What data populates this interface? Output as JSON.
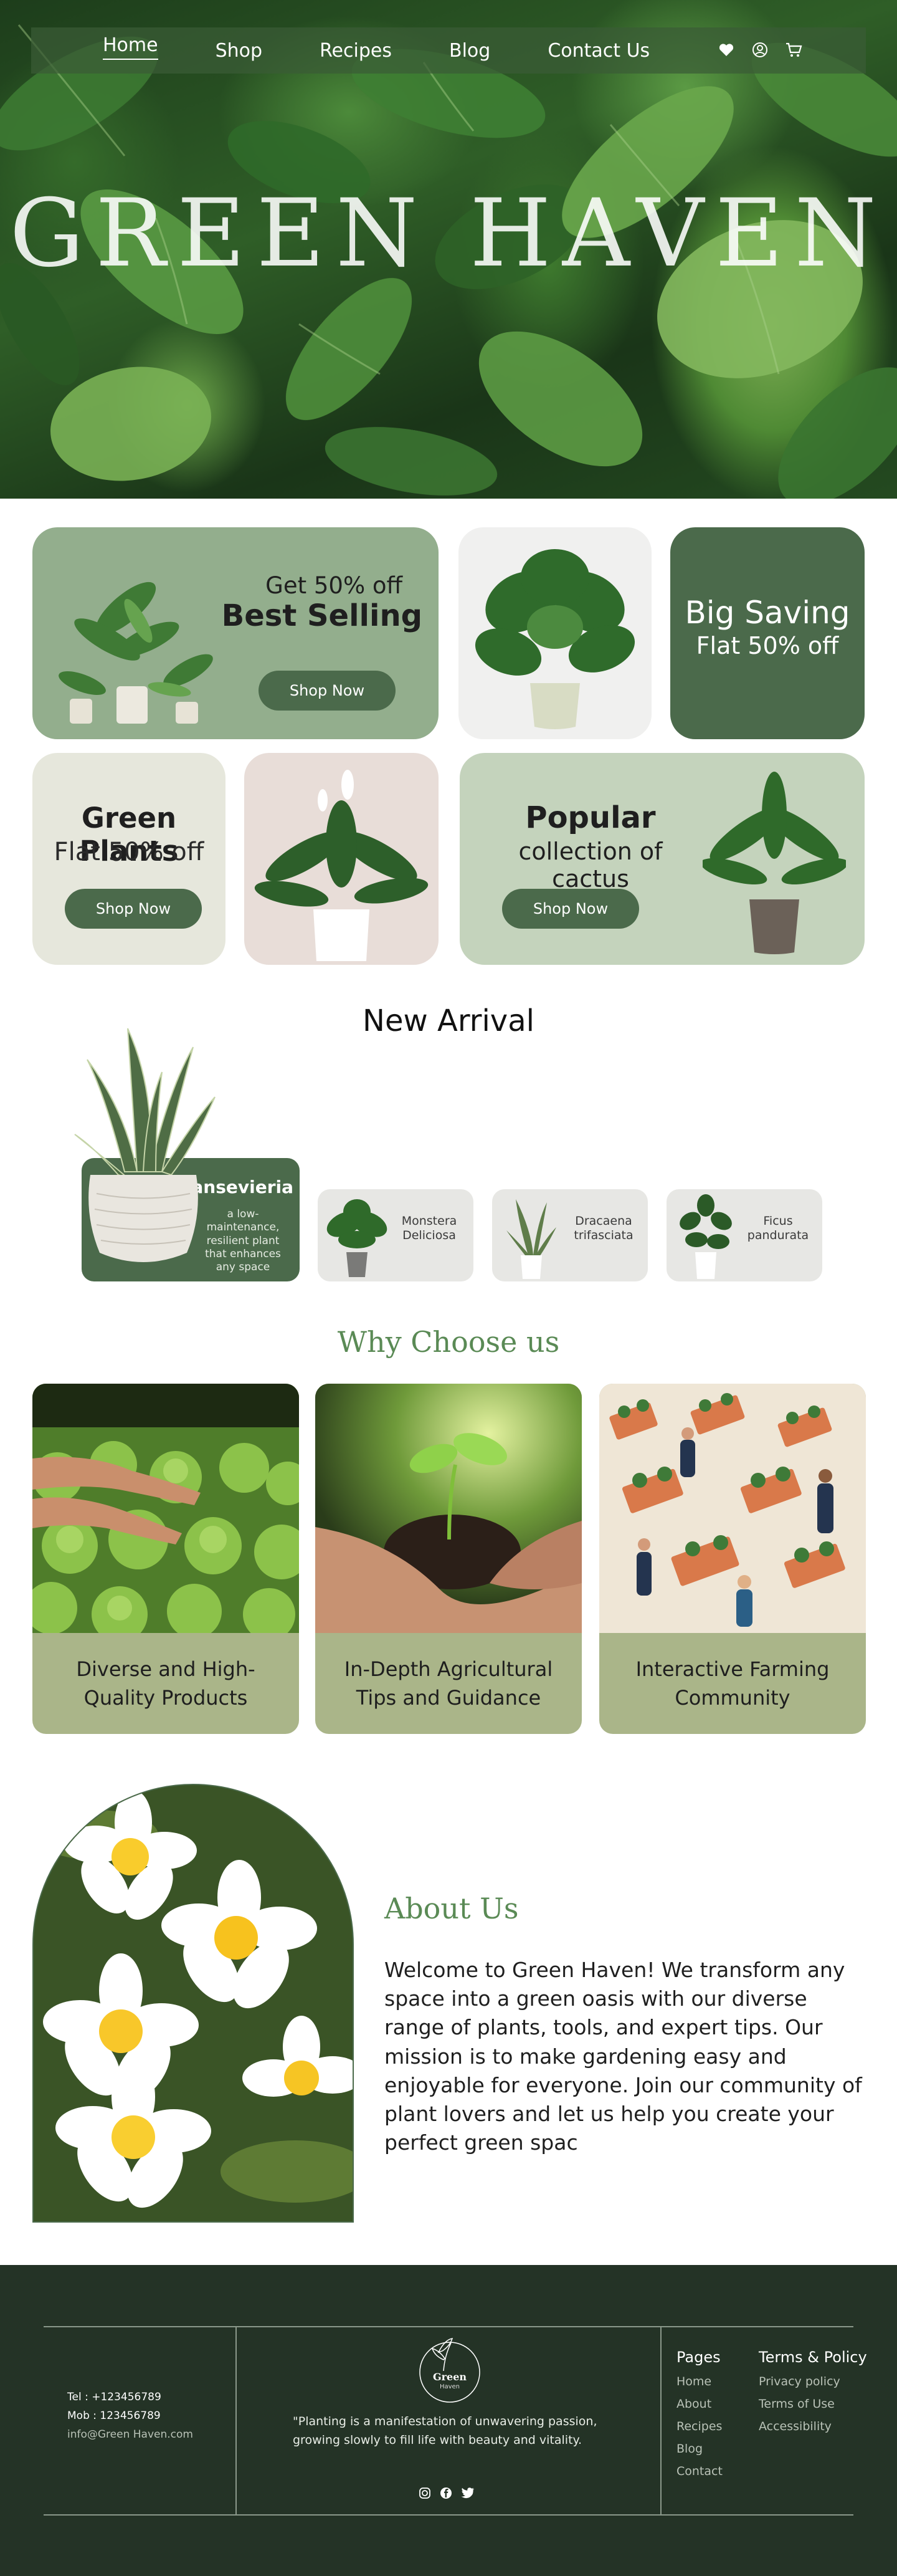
{
  "nav": {
    "items": [
      "Home",
      "Shop",
      "Recipes",
      "Blog",
      "Contact Us"
    ],
    "active": "Home",
    "icons": [
      "heart-icon",
      "user-icon",
      "cart-icon"
    ]
  },
  "hero": {
    "title": "GREEN HAVEN"
  },
  "promo": {
    "best_selling": {
      "line1": "Get 50% off",
      "line2": "Best Selling",
      "button": "Shop Now"
    },
    "big_saving": {
      "line1": "Big Saving",
      "line2": "Flat 50% off"
    },
    "green_plants": {
      "line1": "Green Plants",
      "line2": "Flat 50% off",
      "button": "Shop Now"
    },
    "popular": {
      "line1": "Popular",
      "line2": "collection of cactus",
      "button": "Shop Now"
    }
  },
  "new_arrival": {
    "title": "New Arrival",
    "featured": {
      "name": "Sansevieria",
      "desc": "a low-maintenance, resilient plant that enhances any space"
    },
    "items": [
      "Monstera Deliciosa",
      "Dracaena trifasciata",
      "Ficus pandurata"
    ]
  },
  "why": {
    "title": "Why Choose us",
    "cards": [
      "Diverse and High-Quality Products",
      "In-Depth Agricultural Tips and Guidance",
      "Interactive Farming Community"
    ]
  },
  "about": {
    "title": "About Us",
    "text": "Welcome to Green Haven! We transform any space into a green oasis with our diverse range of plants, tools, and expert tips. Our mission is to make gardening easy and enjoyable for everyone. Join our community of plant lovers and let us help you create your perfect green spac"
  },
  "footer": {
    "tel": "Tel : +123456789",
    "mob": "Mob : 123456789",
    "email": "info@Green Haven.com",
    "logo_text": "Green",
    "logo_sub": "Haven",
    "quote": "\"Planting is a manifestation of unwavering passion, growing slowly to fill life with beauty and vitality.",
    "pages_title": "Pages",
    "pages": [
      "Home",
      "About",
      "Recipes",
      "Blog",
      "Contact"
    ],
    "terms_title": "Terms & Policy",
    "terms": [
      "Privacy policy",
      "Terms of Use",
      "Accessibility"
    ],
    "social_icons": [
      "instagram-icon",
      "facebook-icon",
      "twitter-icon"
    ]
  },
  "colors": {
    "dark_green": "#4b6a4b",
    "sage": "#93ae8d",
    "light_sage": "#c4d3bc",
    "olive_card": "#aab589",
    "footer_bg": "#243326",
    "cream": "#e6e7dc",
    "pink_beige": "#e8ddd8"
  }
}
